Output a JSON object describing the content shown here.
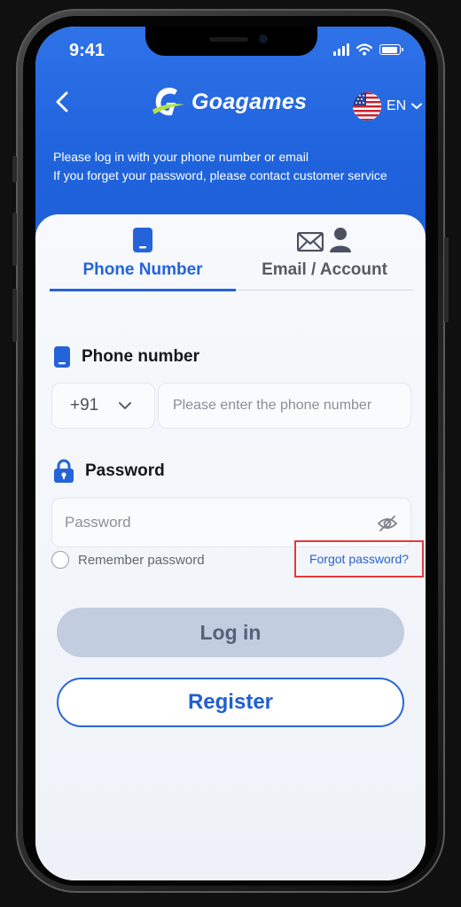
{
  "status_bar": {
    "time": "9:41"
  },
  "header": {
    "brand": "Goagames",
    "language": "EN",
    "intro_lines": [
      "Please log in with your phone number or email",
      "If you forget your password, please contact customer service"
    ]
  },
  "tabs": [
    {
      "label": "Phone Number",
      "active": true,
      "icon": "phone-icon"
    },
    {
      "label": "Email / Account",
      "active": false,
      "icon": "mail-user-icon"
    }
  ],
  "phone_section": {
    "label": "Phone number",
    "country_code": "+91",
    "placeholder": "Please enter the phone number"
  },
  "password_section": {
    "label": "Password",
    "placeholder": "Password"
  },
  "remember_label": "Remember password",
  "forgot_label": "Forgot password?",
  "login_label": "Log in",
  "register_label": "Register",
  "colors": {
    "accent": "#2563d9",
    "header_blue": "#1f63dd",
    "login_disabled": "#c2cddf",
    "highlight_box": "#e03a3a"
  }
}
